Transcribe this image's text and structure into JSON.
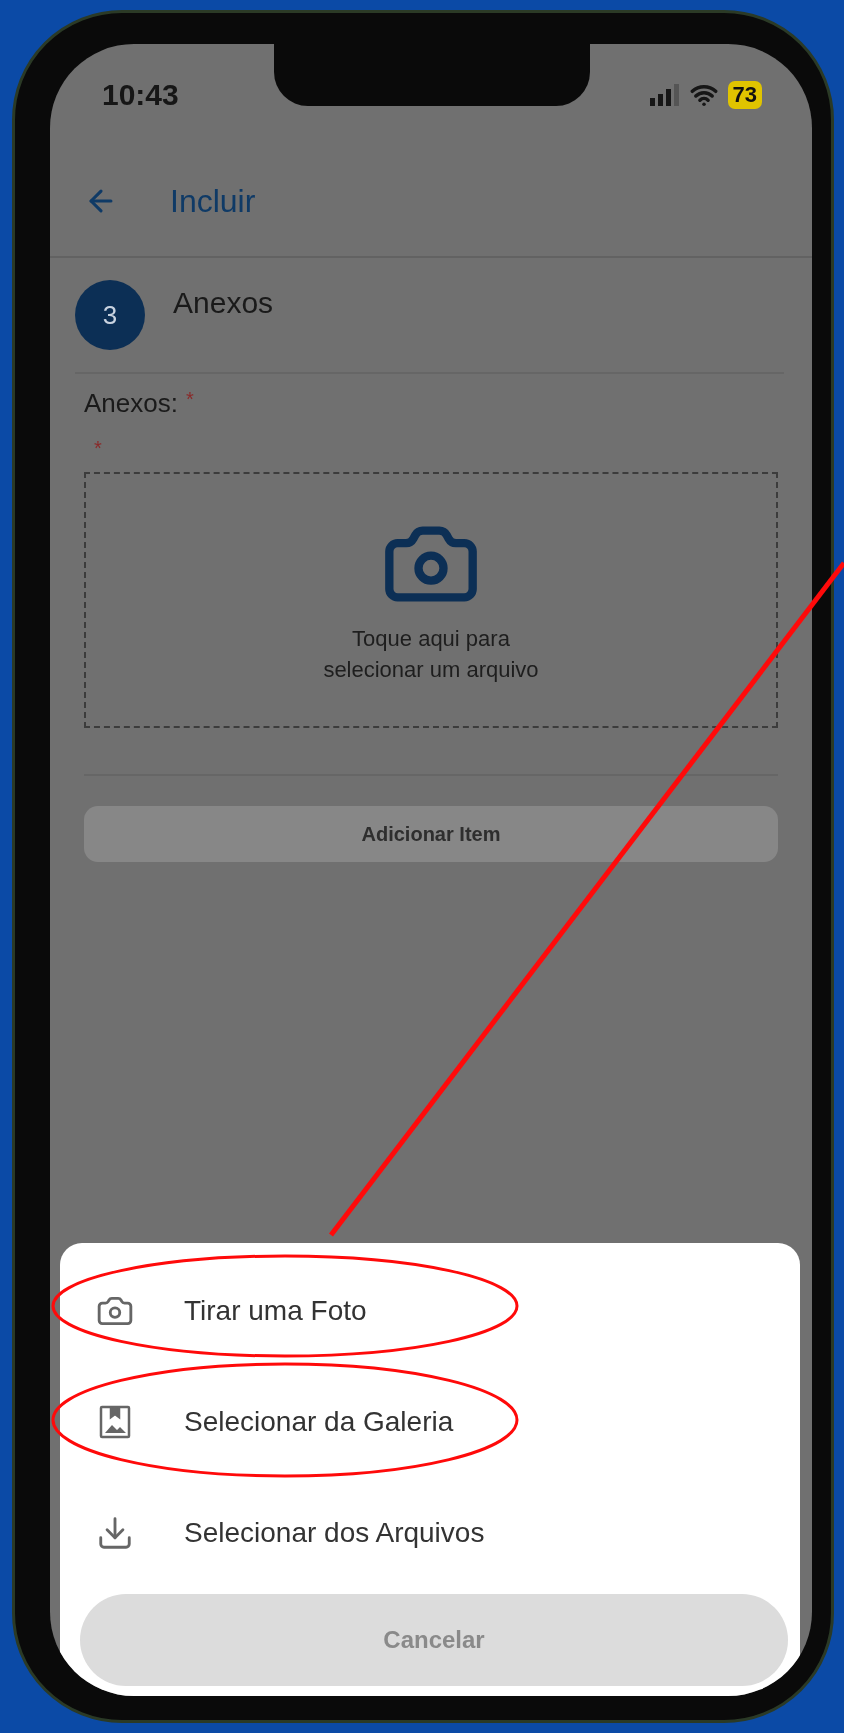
{
  "status_bar": {
    "time": "10:43",
    "battery": "73"
  },
  "header": {
    "title": "Incluir"
  },
  "step": {
    "number": "3",
    "title": "Anexos"
  },
  "field": {
    "label": "Anexos:",
    "required_mark": "*",
    "hint_mark": "*"
  },
  "upload": {
    "text": "Toque aqui para\nselecionar um arquivo"
  },
  "add_button": {
    "label": "Adicionar Item",
    "disabled": true
  },
  "sheet": {
    "options": [
      {
        "kind": "camera",
        "label": "Tirar uma Foto"
      },
      {
        "kind": "gallery",
        "label": "Selecionar da Galeria"
      },
      {
        "kind": "download",
        "label": "Selecionar dos Arquivos"
      }
    ],
    "cancel": "Cancelar"
  }
}
